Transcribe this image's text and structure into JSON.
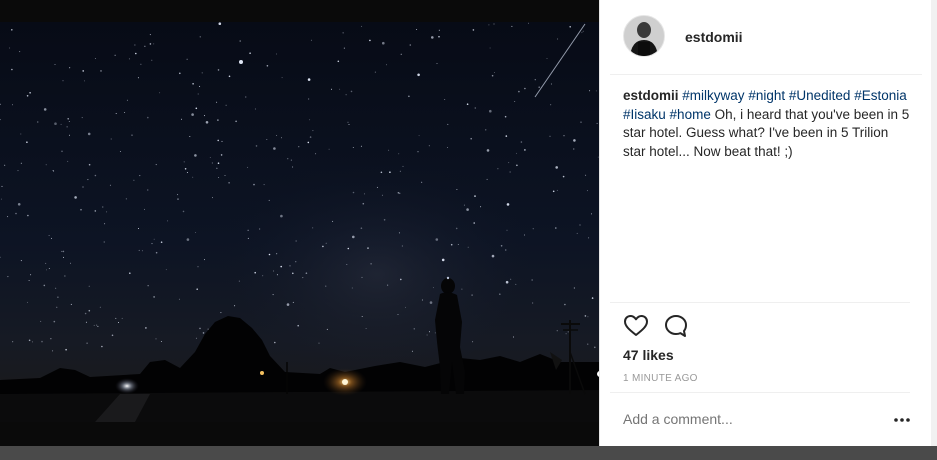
{
  "post": {
    "username": "estdomii",
    "caption_user": "estdomii",
    "hashtags": [
      "#milkyway",
      "#night",
      "#Unedited",
      "#Estonia",
      "#Iisaku",
      "#home"
    ],
    "caption_text": "Oh, i heard that you've been in 5 star hotel. Guess what? I've been in 5 Trilion star hotel... Now beat that! ;)",
    "likes": "47 likes",
    "time": "1 MINUTE AGO"
  },
  "comment": {
    "placeholder": "Add a comment..."
  },
  "icons": {
    "like": "heart-outline-icon",
    "comment": "comment-bubble-icon",
    "more": "more-options-icon"
  },
  "colors": {
    "hashtag": "#003569",
    "text": "#262626",
    "muted": "#999999"
  }
}
